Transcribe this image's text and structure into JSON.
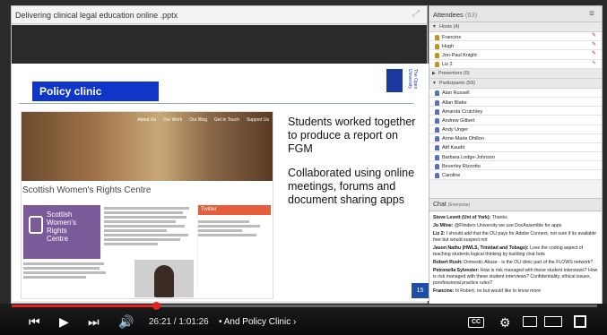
{
  "share": {
    "title": "Delivering clinical legal education online .pptx",
    "slide_title": "Policy clinic",
    "ou_logo_text": "The Open University",
    "slide_number": "15",
    "slide_paragraph_1": "Students worked together to produce a report on FGM",
    "slide_paragraph_2": "Collaborated using online meetings, forums and document sharing apps",
    "web_org": "Scottish Women's Rights Centre",
    "web_logo_text": "Scottish\nWomen's\nRights\nCentre",
    "web_nav": [
      "About Us",
      "Our Work",
      "Our Blog",
      "Get in Touch",
      "Support Us"
    ],
    "web_twitter": "Twitter"
  },
  "attendees": {
    "title": "Attendees",
    "count": "(63)",
    "hosts_label": "Hosts (4)",
    "hosts": [
      "Francine",
      "Hugh",
      "Jon-Paul Knight",
      "Liz 2"
    ],
    "presenters_label": "Presenters (0)",
    "participants_label": "Participants (59)",
    "participants": [
      "Alan Russell",
      "Allan Blake",
      "Amanda Crutchley",
      "Andrew Gilbert",
      "Andy Unger",
      "Anne-Marie Dhillon",
      "Atif Kaudri",
      "Barbara Lodge-Johnson",
      "Beverley Rizzotto",
      "Caroline"
    ]
  },
  "chat": {
    "title": "Chat",
    "scope": "(Everyone)",
    "messages": [
      {
        "author": "Steve Levett (Uni of York):",
        "text": " Thanks"
      },
      {
        "author": "Jo Milne:",
        "text": " @Flinders University we use DocAssemble for apps"
      },
      {
        "author": "Liz 2:",
        "text": " I should add that the OU pays for Adobe Connect, not sure if its available free but would suspect not"
      },
      {
        "author": "Jason Nathu (HWLS, Trinidad and Tobago):",
        "text": " Love the coding aspect of teaching students logical thinking by building chat bots"
      },
      {
        "author": "Robert Rush:",
        "text": " Domestic Abuse - is the OU clinic part of the FLOWS network?"
      },
      {
        "author": "Petronella Sylvester:",
        "text": " How is risk managed with these student interviews? How is risk managed with these student interviews? Confidentiality, ethical issues, porofessional practice rules?"
      },
      {
        "author": "Francine:",
        "text": " hi Robert, no but would like to know more"
      }
    ]
  },
  "player": {
    "time": "26:21 / 1:01:26",
    "chapter": "• And Policy Clinic ›",
    "progress_fraction": 0.246,
    "cc_label": "CC"
  },
  "colors": {
    "accent": "#e2201d",
    "slide_title_bg": "#0f35c9"
  }
}
